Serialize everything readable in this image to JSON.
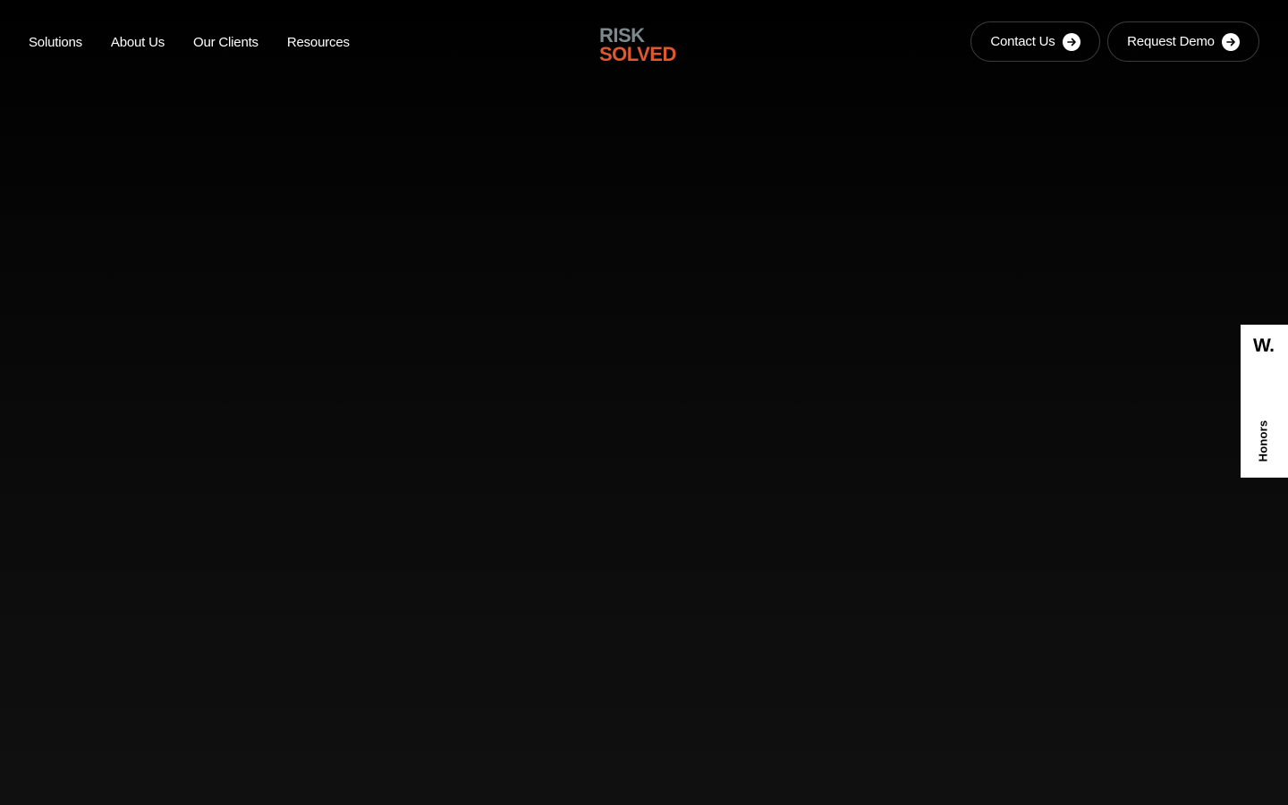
{
  "nav": {
    "items": [
      {
        "label": "Solutions"
      },
      {
        "label": "About Us"
      },
      {
        "label": "Our Clients"
      },
      {
        "label": "Resources"
      }
    ]
  },
  "logo": {
    "line1": "RISK",
    "line2": "SOLVED",
    "colors": {
      "line1": "#7d8a8d",
      "line2": "#e0582e"
    }
  },
  "actions": {
    "contact_label": "Contact Us",
    "demo_label": "Request Demo",
    "icon": "arrow-right-circle-icon"
  },
  "honors_badge": {
    "mark": "W.",
    "label": "Honors"
  },
  "colors": {
    "background": "#000000",
    "text": "#ffffff",
    "button_border": "#3b3b3b",
    "badge_background": "#ffffff"
  }
}
